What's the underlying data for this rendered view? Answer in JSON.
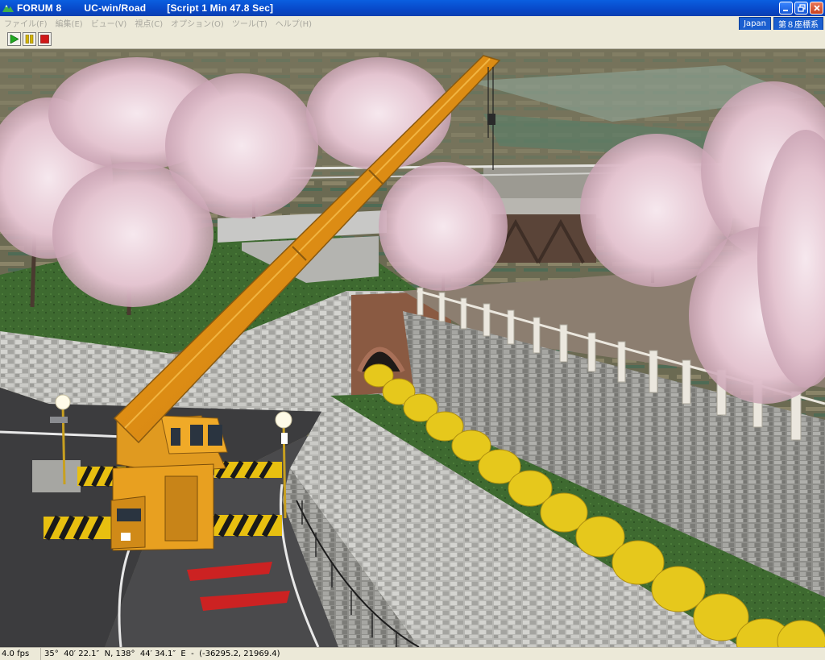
{
  "window": {
    "app": "FORUM 8",
    "product": "UC-win/Road",
    "script_status": "[Script 1 Min 47.8 Sec]"
  },
  "menu": {
    "items": [
      "ファイル(F)",
      "編集(E)",
      "ビュー(V)",
      "視点(C)",
      "オプション(O)",
      "ツール(T)",
      "ヘルプ(H)"
    ],
    "region": "Japan",
    "coordinate_system": "第８座標系"
  },
  "toolbar": {
    "buttons": [
      "play-icon",
      "pause-icon",
      "stop-icon"
    ],
    "colors": {
      "play": "#22a822",
      "pause": "#d4b400",
      "stop": "#d01818"
    }
  },
  "status": {
    "fps": "4.0 fps",
    "coords": "35°  40′ 22.1″  N, 138°  44′ 34.1″  E  -  (-36295.2, 21969.4)"
  }
}
